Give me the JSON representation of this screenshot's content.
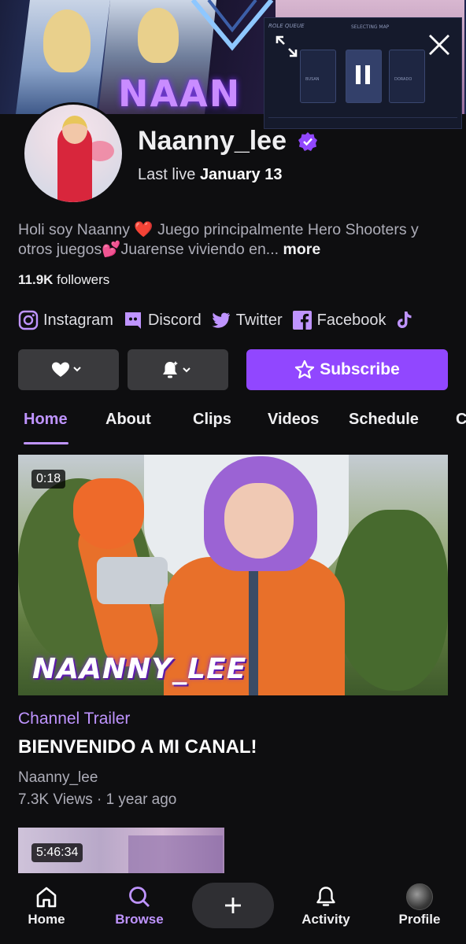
{
  "banner": {
    "title_text": "NAAN"
  },
  "mini_player": {
    "header_left": "ROLE QUEUE",
    "header_center": "SELECTING MAP",
    "card_labels": [
      "BUSAN",
      "",
      "DORADO"
    ]
  },
  "channel": {
    "username": "Naanny_lee",
    "last_live_prefix": "Last live",
    "last_live_date": "January 13",
    "bio_text": "Holi soy Naanny ❤️ Juego principalmente Hero Shooters y otros juegos💕Juarense viviendo en...",
    "bio_more": "more",
    "followers_count": "11.9K",
    "followers_label": "followers"
  },
  "socials": [
    {
      "label": "Instagram",
      "icon": "instagram-icon"
    },
    {
      "label": "Discord",
      "icon": "discord-icon"
    },
    {
      "label": "Twitter",
      "icon": "twitter-icon"
    },
    {
      "label": "Facebook",
      "icon": "facebook-icon"
    },
    {
      "label": "",
      "icon": "tiktok-icon"
    }
  ],
  "actions": {
    "follow_icon": "heart-icon",
    "notify_icon": "bell-icon",
    "subscribe_label": "Subscribe"
  },
  "tabs": [
    {
      "label": "Home",
      "active": true
    },
    {
      "label": "About"
    },
    {
      "label": "Clips"
    },
    {
      "label": "Videos"
    },
    {
      "label": "Schedule"
    },
    {
      "label": "C"
    }
  ],
  "featured_video": {
    "duration": "0:18",
    "thumb_text": "NAANNY_LEE",
    "tag": "Channel Trailer",
    "title": "BIENVENIDO A MI CANAL!",
    "channel": "Naanny_lee",
    "meta": "7.3K Views · 1 year ago"
  },
  "next_video": {
    "duration": "5:46:34"
  },
  "bottom_nav": {
    "home": "Home",
    "browse": "Browse",
    "activity": "Activity",
    "profile": "Profile"
  },
  "colors": {
    "accent": "#9147ff",
    "accent_light": "#bf94ff",
    "background": "#0e0e10",
    "button_grey": "#3a3a3d"
  }
}
